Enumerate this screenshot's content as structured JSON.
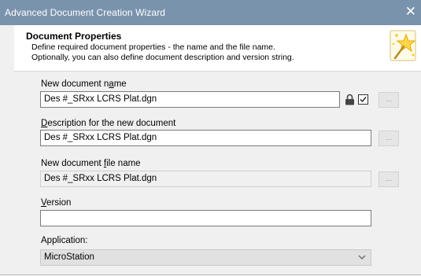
{
  "window": {
    "title": "Advanced Document Creation Wizard",
    "close_glyph": "✕"
  },
  "header": {
    "title": "Document Properties",
    "description_line1": "Define required document properties - the name and the file name.",
    "description_line2": "Optionally, you can also define document description and version string.",
    "icon": "magic-wand-star-icon"
  },
  "form": {
    "name": {
      "label_pre": "New document n",
      "label_accel": "a",
      "label_post": "me",
      "value": "Des #_SRxx LCRS Plat.dgn",
      "lock_icon": "lock-icon",
      "checked": true,
      "button_label": "..."
    },
    "description": {
      "label_accel": "D",
      "label_post": "escription for the new document",
      "value": "Des #_SRxx LCRS Plat.dgn",
      "button_label": "..."
    },
    "file_name": {
      "label_pre": "New document ",
      "label_accel": "f",
      "label_post": "ile name",
      "value": "Des #_SRxx LCRS Plat.dgn",
      "button_label": "..."
    },
    "version": {
      "label_accel": "V",
      "label_post": "ersion",
      "value": ""
    },
    "application": {
      "label": "Application:",
      "selected": "MicroStation"
    }
  }
}
